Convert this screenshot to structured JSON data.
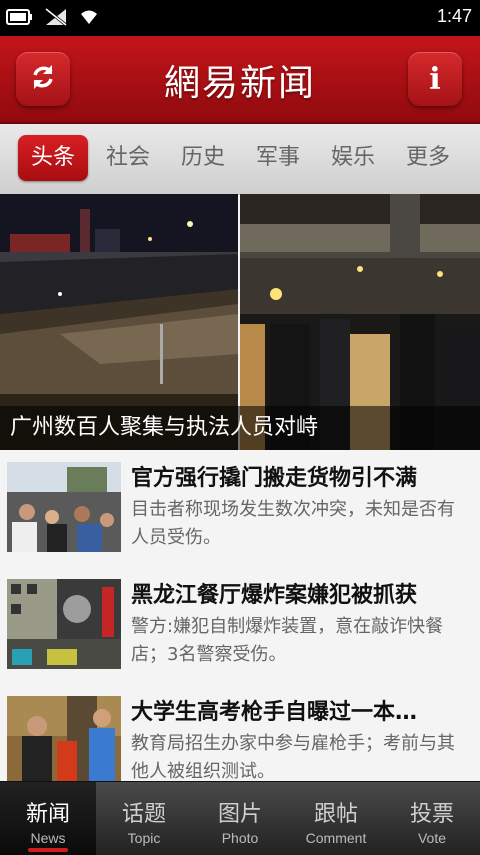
{
  "status_bar": {
    "time": "1:47",
    "icons": [
      "battery-icon",
      "signal-off-icon",
      "wifi-icon"
    ]
  },
  "header": {
    "title": "網易新闻",
    "refresh_icon": "refresh-icon",
    "info_label": "i"
  },
  "tabs": [
    {
      "label": "头条",
      "active": true
    },
    {
      "label": "社会",
      "active": false
    },
    {
      "label": "历史",
      "active": false
    },
    {
      "label": "军事",
      "active": false
    },
    {
      "label": "娱乐",
      "active": false
    },
    {
      "label": "更多",
      "active": false
    }
  ],
  "hero": {
    "caption": "广州数百人聚集与执法人员对峙"
  },
  "news": [
    {
      "title": "官方强行撬门搬走货物引不满",
      "desc": "目击者称现场发生数次冲突，未知是否有人员受伤。"
    },
    {
      "title": "黑龙江餐厅爆炸案嫌犯被抓获",
      "desc": "警方:嫌犯自制爆炸装置，意在敲诈快餐店；3名警察受伤。"
    },
    {
      "title": "大学生高考枪手自曝过一本…",
      "desc": "教育局招生办家中参与雇枪手；考前与其他人被组织测试。"
    }
  ],
  "bottom_nav": [
    {
      "cn": "新闻",
      "en": "News",
      "active": true
    },
    {
      "cn": "话题",
      "en": "Topic",
      "active": false
    },
    {
      "cn": "图片",
      "en": "Photo",
      "active": false
    },
    {
      "cn": "跟帖",
      "en": "Comment",
      "active": false
    },
    {
      "cn": "投票",
      "en": "Vote",
      "active": false
    }
  ],
  "colors": {
    "brand_red": "#c3151a",
    "active_tab": "#d81f23"
  }
}
